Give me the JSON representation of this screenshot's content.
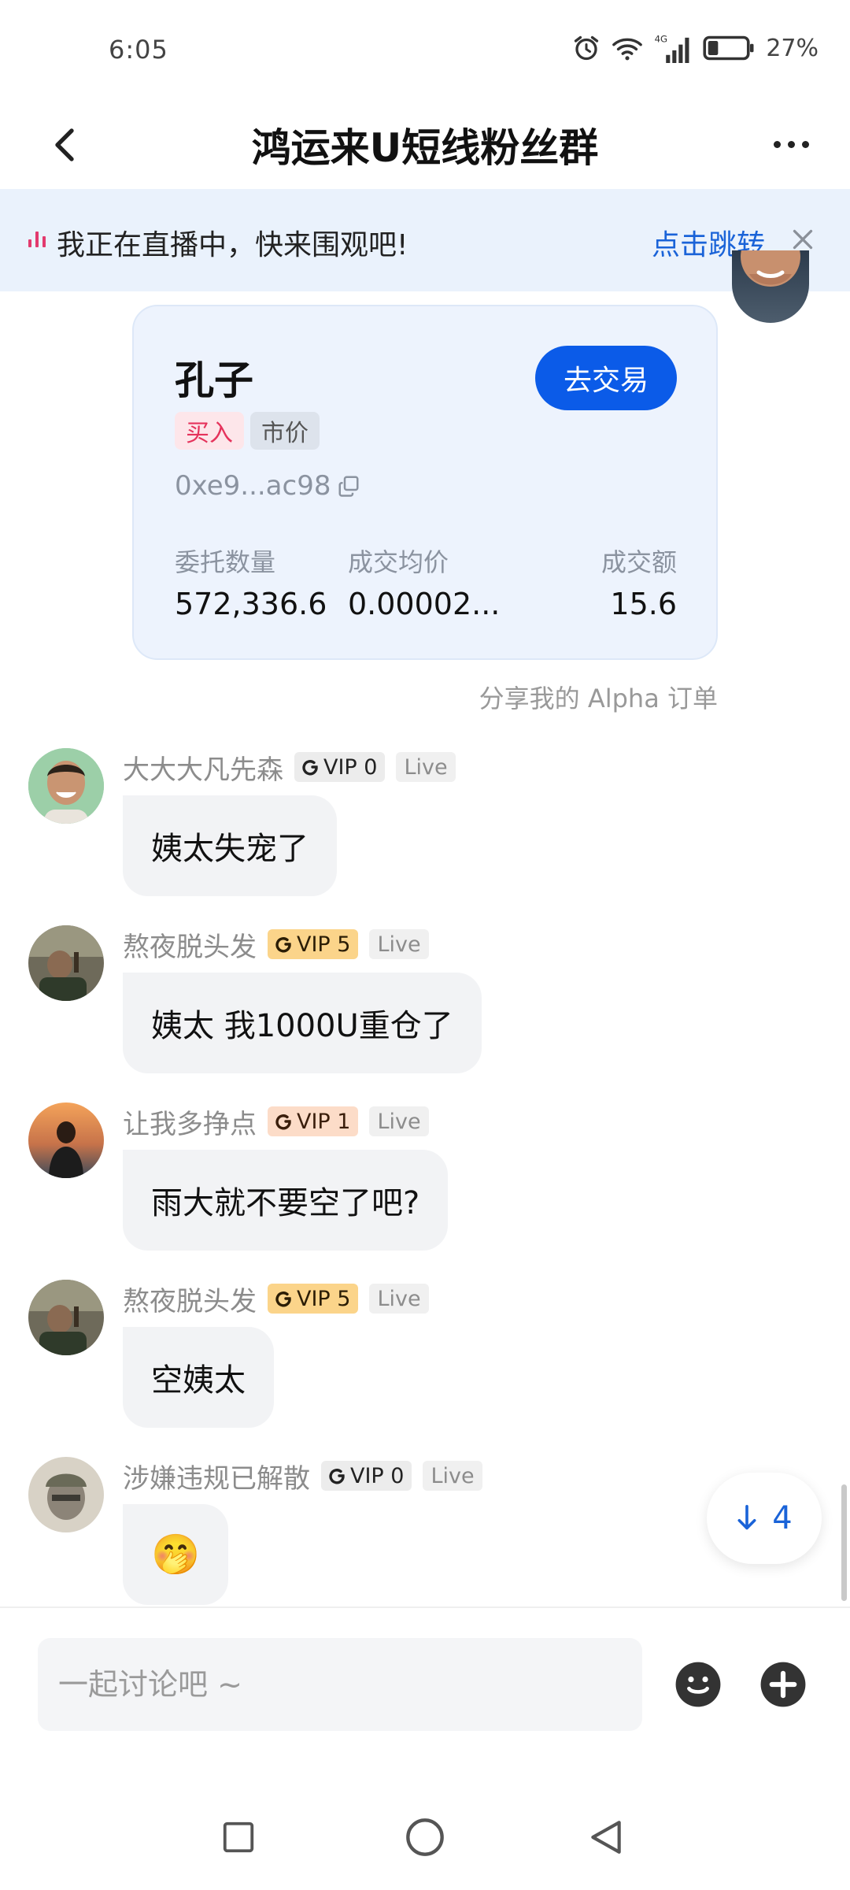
{
  "status_bar": {
    "time": "6:05",
    "network": "4G",
    "battery_pct": "27%",
    "battery_level": 0.27
  },
  "header": {
    "title": "鸿运来U短线粉丝群"
  },
  "live_banner": {
    "text": "我正在直播中，快来围观吧!",
    "link_label": "点击跳转"
  },
  "order_card": {
    "token_name": "孔子",
    "trade_button": "去交易",
    "side_tag": "买入",
    "type_tag": "市价",
    "address": "0xe9...ac98",
    "stats": [
      {
        "label": "委托数量",
        "value": "572,336.6"
      },
      {
        "label": "成交均价",
        "value": "0.00002..."
      },
      {
        "label": "成交额",
        "value": "15.6"
      }
    ],
    "caption": "分享我的 Alpha 订单"
  },
  "messages": [
    {
      "nickname": "大大大凡先森",
      "vip": "VIP 0",
      "live": "Live",
      "text": "姨太失宠了"
    },
    {
      "nickname": "熬夜脱头发",
      "vip": "VIP 5",
      "live": "Live",
      "text": "姨太 我1000U重仓了"
    },
    {
      "nickname": "让我多挣点",
      "vip": "VIP 1",
      "live": "Live",
      "text": "雨大就不要空了吧?"
    },
    {
      "nickname": "熬夜脱头发",
      "vip": "VIP 5",
      "live": "Live",
      "text": "空姨太"
    },
    {
      "nickname": "涉嫌违规已解散",
      "vip": "VIP 0",
      "live": "Live",
      "emoji": "🤭"
    }
  ],
  "scroll_down": {
    "count": "4"
  },
  "input_bar": {
    "placeholder": "一起讨论吧 ~"
  },
  "colors": {
    "accent": "#0b5be8",
    "banner_bg": "#eaf2fc",
    "card_bg": "#edf3fd",
    "buy_red": "#e5335c",
    "vip5_gold": "#fbd48a",
    "vip1_peach": "#fcdcc8"
  },
  "icons": [
    "alarm-icon",
    "wifi-icon",
    "signal-icon",
    "battery-icon",
    "back-arrow-icon",
    "more-icon",
    "live-bars-icon",
    "close-icon",
    "copy-icon",
    "vip-mark-icon",
    "arrow-down-icon",
    "emoji-icon",
    "plus-icon",
    "nav-square-icon",
    "nav-circle-icon",
    "nav-back-triangle-icon"
  ]
}
